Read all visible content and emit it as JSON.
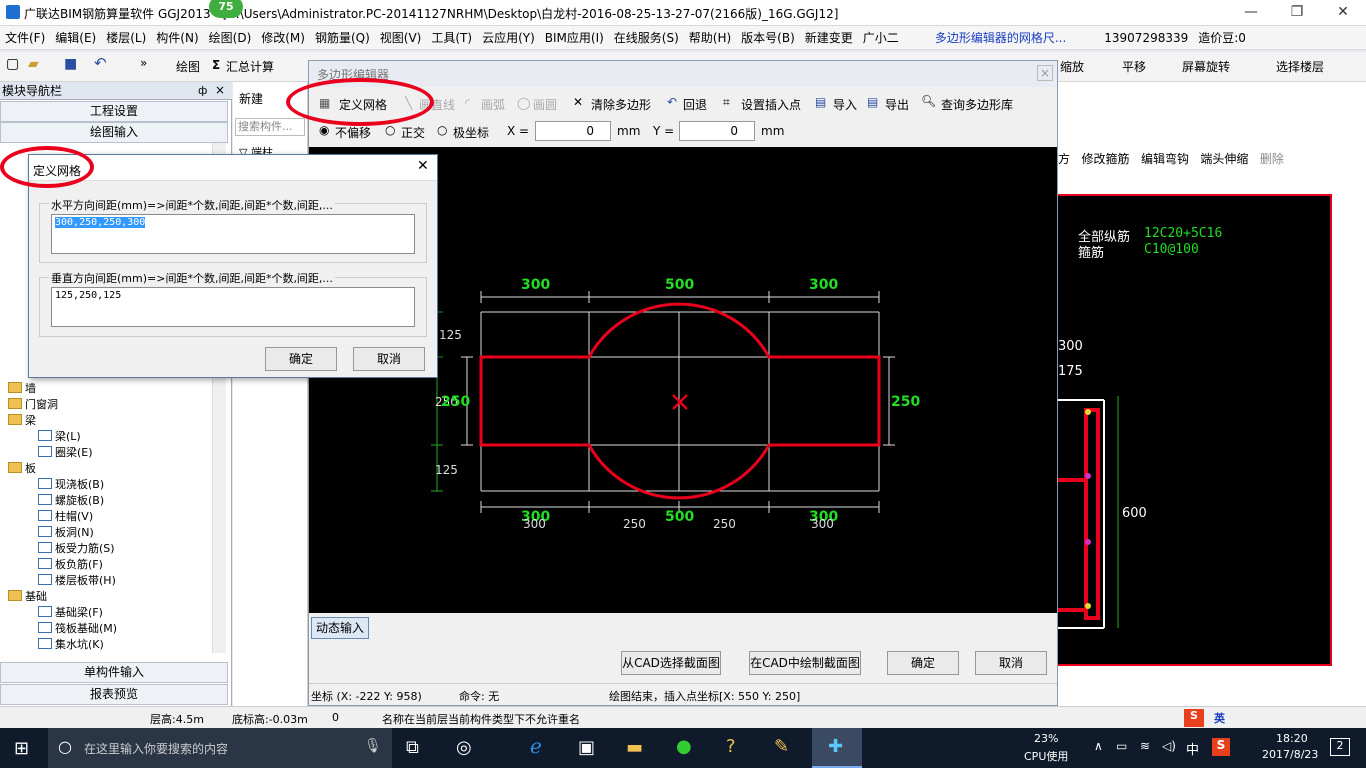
{
  "title_bar": {
    "app_title": "广联达BIM钢筋算量软件 GGJ2013 - [C:\\Users\\Administrator.PC-20141127NRHM\\Desktop\\白龙村-2016-08-25-13-27-07(2166版)_16G.GGJ12]",
    "badge": "75",
    "min": "—",
    "restore": "❐",
    "close": "✕"
  },
  "menu": {
    "items": [
      "文件(F)",
      "编辑(E)",
      "楼层(L)",
      "构件(N)",
      "绘图(D)",
      "修改(M)",
      "钢筋量(Q)",
      "视图(V)",
      "工具(T)",
      "云应用(Y)",
      "BIM应用(I)",
      "在线服务(S)",
      "帮助(H)",
      "版本号(B)"
    ],
    "new_change": "新建变更",
    "assistant": "广小二",
    "notice": "多边形编辑器的网格尺...",
    "phone": "13907298339",
    "cost_bean": "造价豆:0"
  },
  "toolbar": {
    "draw": "绘图",
    "sum": "汇总计算",
    "zoom": "缩放",
    "pan": "平移",
    "rotate": "屏幕旋转",
    "select_floor": "选择楼层"
  },
  "left_panel": {
    "header": "模块导航栏",
    "pin": "ф",
    "close": "×",
    "project_settings": "工程设置",
    "drawing_input": "绘图输入",
    "single_input": "单构件输入",
    "report_preview": "报表预览",
    "tree": [
      "墙",
      "门窗洞",
      "梁",
      "梁(L)",
      "圈梁(E)",
      "板",
      "现浇板(B)",
      "螺旋板(B)",
      "柱帽(V)",
      "板洞(N)",
      "板受力筋(S)",
      "板负筋(F)",
      "楼层板带(H)",
      "基础",
      "基础梁(F)",
      "筏板基础(M)",
      "集水坑(K)"
    ]
  },
  "mid_panel": {
    "new_label": "新建",
    "search_placeholder": "搜索构件...",
    "filter": "端柱"
  },
  "editor": {
    "title": "多边形编辑器",
    "define_grid": "定义网格",
    "draw_line": "画直线",
    "draw_arc": "画弧",
    "draw_circle": "画圆",
    "clear_polygon": "清除多边形",
    "undo": "回退",
    "set_insert_point": "设置插入点",
    "import": "导入",
    "export": "导出",
    "query_lib": "查询多边形库",
    "no_offset": "不偏移",
    "ortho": "正交",
    "polar": "极坐标",
    "x_label": "X =",
    "x_value": "0",
    "y_label": "Y =",
    "y_value": "0",
    "unit": "mm",
    "dynamic_input": "动态输入",
    "from_cad": "从CAD选择截面图",
    "draw_in_cad": "在CAD中绘制截面图",
    "ok": "确定",
    "cancel": "取消",
    "coords": "坐标 (X: -222 Y: 958)",
    "command": "命令: 无",
    "status_msg": "绘图结束，插入点坐标[X: 550 Y: 250]"
  },
  "canvas": {
    "top_dims": [
      "300",
      "500",
      "300"
    ],
    "bottom_dims_green": [
      "300",
      "500",
      "300"
    ],
    "bottom_dims_white": [
      "300",
      "250",
      "250",
      "300"
    ],
    "left_dims": [
      "125",
      "250",
      "125"
    ],
    "left_green": "250",
    "right_green": "250"
  },
  "right_panel": {
    "tools": [
      "方",
      "修改箍筋",
      "编辑弯钩",
      "端头伸缩",
      "删除"
    ],
    "all_long": "全部纵筋",
    "all_long_val": "12C20+5C16",
    "stirrup": "箍筋",
    "stirrup_val": "C10@100",
    "d300": "300",
    "d175": "175",
    "d600": "600"
  },
  "dialog": {
    "title": "定义网格",
    "h_label": "水平方向间距(mm)=>间距*个数,间距,间距*个数,间距,...",
    "h_value": "300,250,250,300",
    "v_label": "垂直方向间距(mm)=>间距*个数,间距,间距*个数,间距,...",
    "v_value": "125,250,125",
    "ok": "确定",
    "cancel": "取消"
  },
  "status": {
    "floor_height": "层高:4.5m",
    "base_height": "底标高:-0.03m",
    "zero": "0",
    "message": "名称在当前层当前构件类型下不允许重名"
  },
  "taskbar": {
    "search": "在这里输入你要搜索的内容",
    "cpu_pct": "23%",
    "cpu_label": "CPU使用",
    "ime": "中",
    "time": "18:20",
    "date": "2017/8/23",
    "notif": "2",
    "ime_en": "英"
  },
  "colors": {
    "accent": "#1f6fd1",
    "red": "#e8001c",
    "green": "#22dd22",
    "canvas_bg": "#000000"
  }
}
